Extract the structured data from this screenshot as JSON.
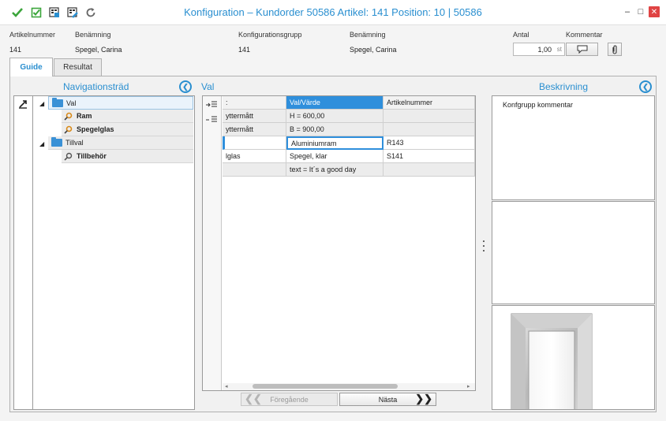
{
  "window": {
    "title": "Konfiguration – Kundorder 50586 Artikel: 141 Position: 10 | 50586",
    "toolbar_icons": [
      "check-icon",
      "checkbox-check-icon",
      "grid-save-icon",
      "grid-edit-icon",
      "refresh-icon"
    ],
    "controls": [
      "minimize-icon",
      "maximize-icon",
      "close-icon"
    ]
  },
  "header": {
    "artikelnummer_label": "Artikelnummer",
    "artikelnummer_value": "141",
    "benamning_label": "Benämning",
    "benamning_value": "Spegel, Carina",
    "konfigurationsgrupp_label": "Konfigurationsgrupp",
    "konfigurationsgrupp_value": "141",
    "benamning2_label": "Benämning",
    "benamning2_value": "Spegel, Carina",
    "antal_label": "Antal",
    "antal_value": "1,00",
    "antal_unit": "st",
    "kommentar_label": "Kommentar"
  },
  "tabs": [
    {
      "label": "Guide",
      "active": true
    },
    {
      "label": "Resultat",
      "active": false
    }
  ],
  "navigation": {
    "title": "Navigationsträd",
    "tree": [
      {
        "label": "Val",
        "type": "folder",
        "expanded": true,
        "selected": true
      },
      {
        "label": "Ram",
        "type": "item",
        "status": "key"
      },
      {
        "label": "Spegelglas",
        "type": "item",
        "status": "key"
      },
      {
        "label": "Tillval",
        "type": "folder",
        "expanded": true
      },
      {
        "label": "Tillbehör",
        "type": "item",
        "status": "search"
      }
    ]
  },
  "grid": {
    "title": "Val",
    "columns": [
      ":",
      "Val/Värde",
      "Artikelnummer"
    ],
    "rows": [
      [
        "yttermått",
        "H = 600,00",
        ""
      ],
      [
        " yttermått",
        "B = 900,00",
        ""
      ],
      [
        "",
        "Aluminiumram",
        "R143"
      ],
      [
        "lglas",
        "Spegel, klar",
        "S141"
      ],
      [
        "",
        "text = It´s a good day",
        ""
      ]
    ],
    "prev_label": "Föregående",
    "next_label": "Nästa"
  },
  "description": {
    "title": "Beskrivning",
    "comment": "Konfgrupp kommentar"
  },
  "colors": {
    "accent": "#2a8fd0",
    "selection": "#2f8fdc",
    "close": "#e04343",
    "check": "#3ba53b"
  }
}
